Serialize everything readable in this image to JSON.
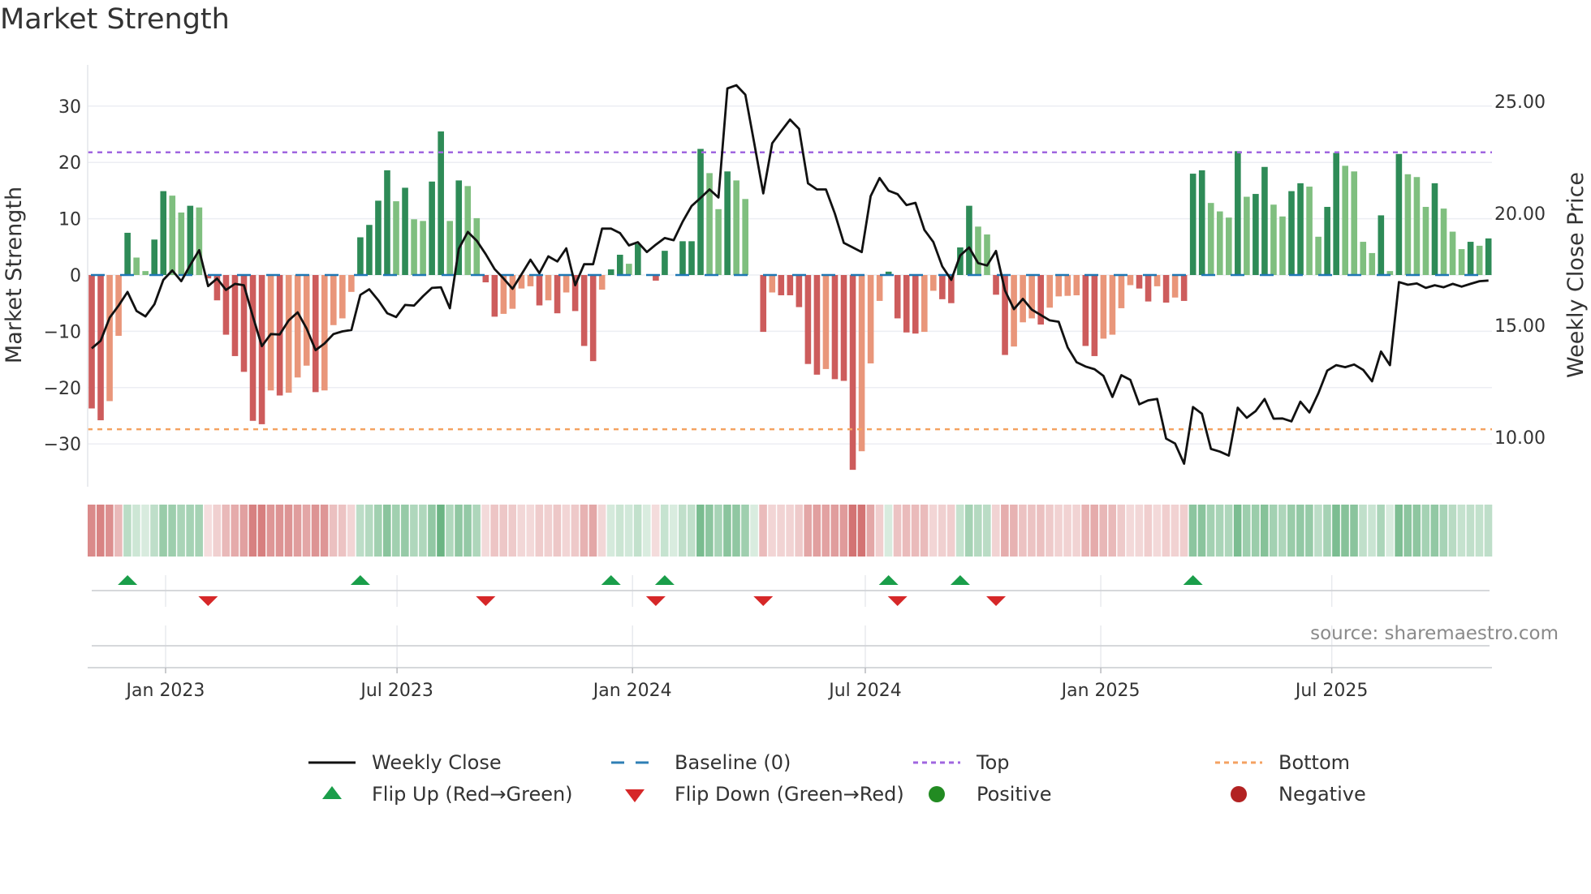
{
  "title": "Market Strength",
  "source": "source: sharemaestro.com",
  "legend": {
    "weekly_close": "Weekly Close",
    "baseline": "Baseline (0)",
    "top": "Top",
    "bottom": "Bottom",
    "flip_up": "Flip Up (Red→Green)",
    "flip_down": "Flip Down (Green→Red)",
    "positive": "Positive",
    "negative": "Negative"
  },
  "colors": {
    "pos_strong": "#2e8b57",
    "pos_weak": "#7fbf7f",
    "neg_strong": "#cd5c5c",
    "neg_weak": "#e9967a",
    "line": "#111111",
    "baseline": "#1f77b4",
    "top": "#a066e0",
    "bottom": "#f4a261",
    "flip_up": "#1a9e4a",
    "flip_down": "#d62728",
    "positive": "#228b22",
    "negative": "#b22222"
  },
  "chart_data": {
    "type": "bar+line",
    "title": "Market Strength",
    "ylabel": "Market Strength",
    "y2label": "Weekly Close Price",
    "ylim": [
      -37,
      37
    ],
    "y2lim": [
      7.9,
      26.8
    ],
    "yticks": [
      30,
      20,
      10,
      0,
      -10,
      -20,
      -30
    ],
    "ytick_labels": [
      "30",
      "20",
      "10",
      "0",
      "−10",
      "−20",
      "−30"
    ],
    "y2ticks": [
      25,
      20,
      15,
      10
    ],
    "y2tick_labels": [
      "25.00",
      "20.00",
      "15.00",
      "10.00"
    ],
    "xticks": [
      {
        "week": 8.25,
        "label": "Jan 2023"
      },
      {
        "week": 34.1,
        "label": "Jul 2023"
      },
      {
        "week": 60.4,
        "label": "Jan 2024"
      },
      {
        "week": 86.4,
        "label": "Jul 2024"
      },
      {
        "week": 112.7,
        "label": "Jan 2025"
      },
      {
        "week": 138.5,
        "label": "Jul 2025"
      }
    ],
    "top_level": 21.8,
    "bottom_level": -27.4,
    "baseline": 0,
    "strength": [
      -23.7,
      -25.8,
      -22.4,
      -10.8,
      7.5,
      3.1,
      0.7,
      6.3,
      14.9,
      14.1,
      11.1,
      12.3,
      12.0,
      -0.6,
      -4.5,
      -10.6,
      -14.4,
      -17.2,
      -25.9,
      -26.5,
      -20.5,
      -21.4,
      -20.9,
      -18.2,
      -16.1,
      -20.8,
      -20.5,
      -8.9,
      -7.7,
      -3.0,
      6.7,
      8.9,
      13.2,
      18.6,
      13.1,
      15.5,
      9.9,
      9.6,
      16.6,
      25.5,
      9.6,
      16.8,
      15.8,
      10.1,
      -1.3,
      -7.4,
      -6.9,
      -6.0,
      -2.4,
      -2.0,
      -5.4,
      -4.5,
      -6.8,
      -3.1,
      -6.4,
      -12.6,
      -15.3,
      -2.6,
      1.0,
      3.6,
      2.0,
      5.5,
      0,
      -1.0,
      4.3,
      0,
      6.0,
      6.0,
      22.4,
      18.1,
      11.7,
      18.4,
      16.8,
      13.5,
      0,
      -10.1,
      -3.1,
      -3.6,
      -3.6,
      -5.7,
      -15.8,
      -17.7,
      -16.7,
      -18.5,
      -18.8,
      -34.6,
      -31.3,
      -15.7,
      -4.6,
      0.6,
      -7.7,
      -10.2,
      -10.4,
      -10.1,
      -2.8,
      -4.3,
      -5.0,
      4.9,
      12.3,
      8.6,
      7.2,
      -3.5,
      -14.2,
      -12.7,
      -8.4,
      -7.7,
      -8.8,
      -5.8,
      -3.8,
      -3.7,
      -3.6,
      -12.6,
      -14.4,
      -11.3,
      -10.6,
      -5.9,
      -1.8,
      -2.4,
      -4.7,
      -2.0,
      -4.9,
      -4.0,
      -4.6,
      18.0,
      18.6,
      12.8,
      11.3,
      10.2,
      22.0,
      13.9,
      14.4,
      19.2,
      12.5,
      10.4,
      14.9,
      16.3,
      15.7,
      6.8,
      12.1,
      21.7,
      19.4,
      18.4,
      5.9,
      3.9,
      10.6,
      0.7,
      21.5,
      17.9,
      17.4,
      12.1,
      16.3,
      11.8,
      7.7,
      4.6,
      5.9,
      5.2,
      6.5
    ],
    "weekly_close": [
      13.97,
      14.31,
      15.34,
      15.88,
      16.49,
      15.64,
      15.4,
      15.94,
      17.03,
      17.45,
      16.97,
      17.69,
      18.36,
      16.75,
      17.09,
      16.58,
      16.85,
      16.79,
      15.4,
      14.07,
      14.61,
      14.59,
      15.22,
      15.58,
      14.86,
      13.89,
      14.19,
      14.61,
      14.73,
      14.79,
      16.36,
      16.61,
      16.12,
      15.54,
      15.37,
      15.91,
      15.88,
      16.3,
      16.67,
      16.7,
      15.76,
      18.42,
      19.17,
      18.78,
      18.18,
      17.51,
      17.09,
      16.63,
      17.27,
      17.93,
      17.33,
      18.08,
      17.85,
      18.44,
      16.79,
      17.73,
      17.73,
      19.32,
      19.32,
      19.12,
      18.57,
      18.71,
      18.27,
      18.6,
      18.9,
      18.8,
      19.63,
      20.33,
      20.69,
      21.07,
      20.71,
      25.58,
      25.72,
      25.3,
      23.13,
      20.89,
      23.13,
      23.67,
      24.19,
      23.77,
      21.34,
      21.07,
      21.07,
      19.99,
      18.68,
      18.48,
      18.27,
      20.77,
      21.58,
      21.01,
      20.86,
      20.37,
      20.47,
      19.26,
      18.72,
      17.63,
      17.03,
      18.12,
      18.48,
      17.78,
      17.67,
      18.32,
      16.55,
      15.72,
      16.18,
      15.7,
      15.46,
      15.22,
      15.16,
      14.01,
      13.35,
      13.16,
      13.04,
      12.74,
      11.8,
      12.77,
      12.56,
      11.47,
      11.65,
      11.71,
      9.94,
      9.72,
      8.82,
      11.35,
      11.05,
      9.48,
      9.36,
      9.18,
      11.32,
      10.87,
      11.17,
      11.71,
      10.83,
      10.84,
      10.71,
      11.59,
      11.11,
      11.96,
      12.98,
      13.22,
      13.13,
      13.25,
      13.01,
      12.5,
      13.83,
      13.22,
      16.93,
      16.81,
      16.87,
      16.67,
      16.79,
      16.7,
      16.85,
      16.73,
      16.85,
      16.97,
      17.0
    ]
  }
}
